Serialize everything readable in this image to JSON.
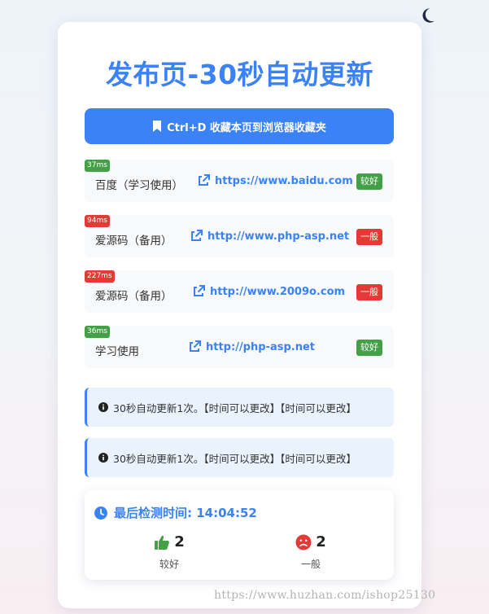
{
  "header": {
    "title": "发布页-30秒自动更新",
    "theme_toggle_icon": "moon-icon"
  },
  "bookmark": {
    "label": "Ctrl+D 收藏本页到浏览器收藏夹",
    "icon": "bookmark-icon"
  },
  "sites": [
    {
      "latency": "37ms",
      "name": "百度（学习使用）",
      "url": "https://www.baidu.com",
      "status": "较好"
    },
    {
      "latency": "94ms",
      "name": "爱源码（备用）",
      "url": "http://www.php-asp.net",
      "status": "一般"
    },
    {
      "latency": "227ms",
      "name": "爱源码（备用）",
      "url": "http://www.2009o.com",
      "status": "一般"
    },
    {
      "latency": "36ms",
      "name": "学习使用",
      "url": "http://php-asp.net",
      "status": "较好"
    }
  ],
  "notices": [
    {
      "text": "30秒自动更新1次。【时间可以更改】【时间可以更改】"
    },
    {
      "text": "30秒自动更新1次。【时间可以更改】【时间可以更改】"
    }
  ],
  "summary": {
    "check_time": "最后检测时间: 14:04:52",
    "good_count": "2",
    "good_label": "较好",
    "normal_count": "2",
    "normal_label": "一般"
  },
  "watermark": "https://www.huzhan.com/ishop25130",
  "colors": {
    "accent": "#3b82f6",
    "good": "#43a047",
    "bad": "#e53935"
  }
}
